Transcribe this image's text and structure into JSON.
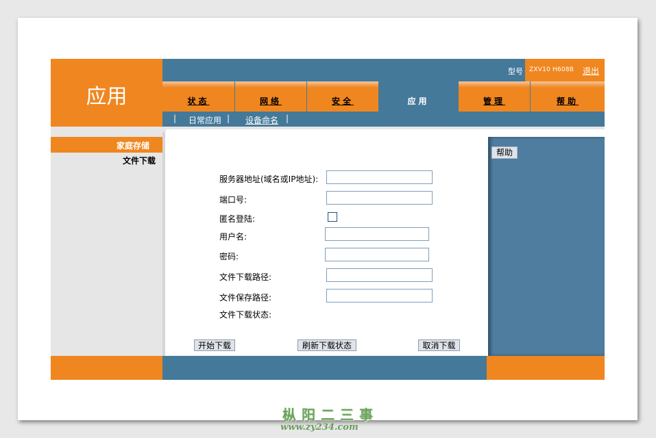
{
  "header": {
    "title": "应用",
    "model_label": "型号",
    "model_value": "ZXV10 H608B",
    "logout": "退出"
  },
  "tabs": [
    {
      "label": "状态",
      "active": false
    },
    {
      "label": "网络",
      "active": false
    },
    {
      "label": "安全",
      "active": false
    },
    {
      "label": "应用",
      "active": true
    },
    {
      "label": "管理",
      "active": false
    },
    {
      "label": "帮助",
      "active": false
    }
  ],
  "subnav": {
    "sep": "|",
    "item1": "日常应用",
    "item2": "设备命名"
  },
  "sidebar": {
    "selected": "家庭存储",
    "item": "文件下载"
  },
  "help_button": "帮助",
  "form": {
    "server_label": "服务器地址(域名或IP地址):",
    "port_label": "端口号:",
    "anonymous_label": "匿名登陆:",
    "username_label": "用户名:",
    "password_label": "密码:",
    "download_path_label": "文件下载路径:",
    "save_path_label": "文件保存路径:",
    "status_label": "文件下载状态:",
    "server_value": "",
    "port_value": "",
    "anonymous_checked": false,
    "username_value": "",
    "password_value": "",
    "download_path_value": "",
    "save_path_value": ""
  },
  "buttons": {
    "start": "开始下载",
    "refresh": "刷新下载状态",
    "cancel": "取消下载"
  },
  "watermark": {
    "line1": "枞阳二三事",
    "line2": "www.zy234.com"
  },
  "colors": {
    "orange": "#f0861f",
    "blue": "#44799a",
    "side_blue": "#4f7d9f"
  }
}
